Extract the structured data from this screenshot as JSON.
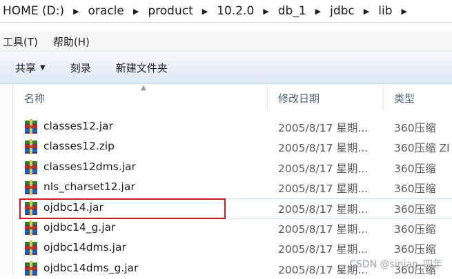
{
  "address": {
    "crumbs": [
      "HOME (D:)",
      "oracle",
      "product",
      "10.2.0",
      "db_1",
      "jdbc",
      "lib"
    ]
  },
  "menubar": {
    "items": [
      "工具(T)",
      "帮助(H)"
    ]
  },
  "commandbar": {
    "share": "共享",
    "burn": "刻录",
    "new_folder": "新建文件夹"
  },
  "columns": {
    "name": "名称",
    "modified": "修改日期",
    "type": "类型"
  },
  "files": [
    {
      "name": "classes12.jar",
      "date": "2005/8/17 星期...",
      "type": "360压缩"
    },
    {
      "name": "classes12.zip",
      "date": "2005/8/17 星期...",
      "type": "360压缩 ZI"
    },
    {
      "name": "classes12dms.jar",
      "date": "2005/8/17 星期...",
      "type": "360压缩"
    },
    {
      "name": "nls_charset12.jar",
      "date": "2005/8/17 星期...",
      "type": "360压缩"
    },
    {
      "name": "ojdbc14.jar",
      "date": "2005/8/17 星期...",
      "type": "360压缩"
    },
    {
      "name": "ojdbc14_g.jar",
      "date": "2005/8/17 星期...",
      "type": "360压缩"
    },
    {
      "name": "ojdbc14dms.jar",
      "date": "2005/8/17 星期...",
      "type": "360压缩"
    },
    {
      "name": "ojdbc14dms_g.jar",
      "date": "2005/8/17 星期...",
      "type": "360压缩"
    }
  ],
  "highlighted_file": "ojdbc14.jar",
  "watermark": "CSDN @sinian_四年",
  "colors": {
    "highlight_border": "#cc1b22",
    "commandbar_top": "#f4f8fc",
    "commandbar_bottom": "#dde8f3"
  }
}
